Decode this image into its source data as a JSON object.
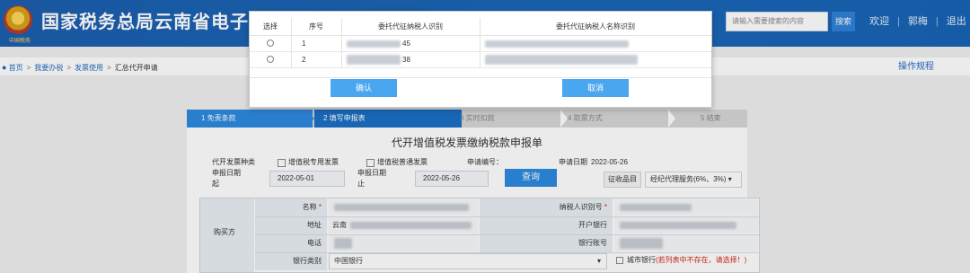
{
  "header": {
    "site_title": "国家税务总局云南省电子税务局",
    "emblem_caption": "中国税务",
    "search_placeholder": "请输入需要搜索的内容",
    "search_label": "搜索",
    "links": [
      "欢迎",
      "郭梅",
      "退出"
    ]
  },
  "breadcrumb": {
    "items": [
      "首页",
      "我要办税",
      "发票使用",
      "汇总代开申请"
    ],
    "right_link": "操作规程"
  },
  "steps": [
    "1 免责条款",
    "2 填写申报表",
    "3 实时扣款",
    "4 取票方式",
    "5 结束"
  ],
  "form": {
    "title": "代开增值税发票缴纳税款申报单",
    "invoice_type_label": "代开发票种类",
    "invoice_option_1": "增值税专用发票",
    "invoice_option_2": "增值税普通发票",
    "apply_no_label": "申请编号：",
    "apply_date_label": "申请日期",
    "apply_date": "2022-05-26",
    "start_date_label_1": "申报日期",
    "start_date_label_2": "起",
    "start_date": "2022-05-01",
    "end_date_label_1": "申报日期",
    "end_date_label_2": "止",
    "end_date": "2022-05-26",
    "query_label": "查询",
    "tax_item_label": "征收品目",
    "tax_item_value": "经纪代理服务(6%、3%)",
    "buyer_label": "购买方",
    "name_label": "名称",
    "taxpayer_id_label": "纳税人识别号",
    "address_label": "地址",
    "address_prefix": "云南",
    "bank_label": "开户银行",
    "phone_label": "电话",
    "account_label": "银行账号",
    "bank_type_label": "银行类别",
    "bank_type_value": "中国银行",
    "city_bank_label": "城市银行",
    "city_bank_hint": "(若列表中不存在，请选择！)"
  },
  "modal": {
    "headers": [
      "选择",
      "序号",
      "委托代征纳税人识别",
      "委托代征纳税人名称识别"
    ],
    "rows": [
      {
        "index": "1",
        "id_suffix": "45"
      },
      {
        "index": "2",
        "id_suffix": "38"
      }
    ],
    "confirm_label": "确认",
    "cancel_label": "取消"
  },
  "colors": {
    "header_blue": "#1a66b8",
    "step_active": "#2d8ae0",
    "button_blue": "#4ba6f0",
    "warning_red": "#d12a1a"
  }
}
